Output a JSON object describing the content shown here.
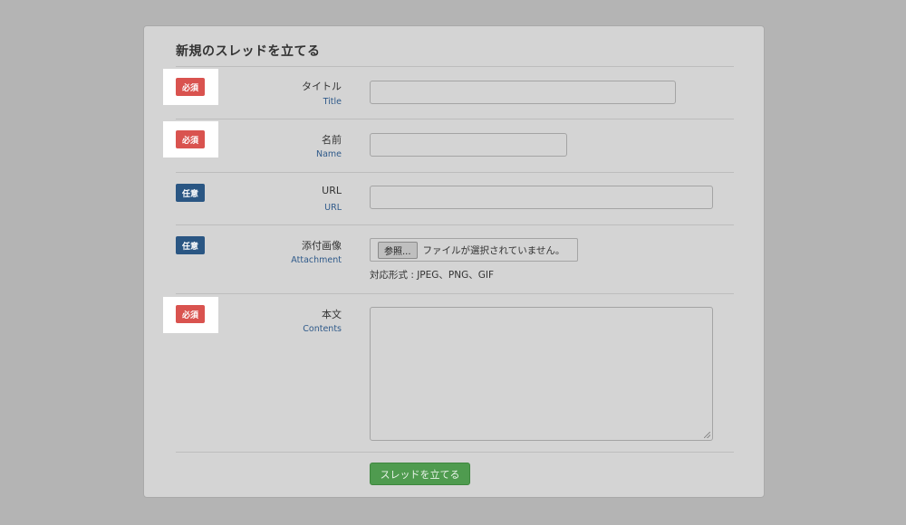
{
  "form": {
    "title": "新規のスレッドを立てる",
    "badges": {
      "required": "必須",
      "optional": "任意"
    },
    "fields": {
      "title": {
        "label": "タイトル",
        "sub": "Title"
      },
      "name": {
        "label": "名前",
        "sub": "Name"
      },
      "url": {
        "label": "URL",
        "sub": "URL"
      },
      "attachment": {
        "label": "添付画像",
        "sub": "Attachment",
        "browse": "参照...",
        "status": "ファイルが選択されていません。",
        "hint": "対応形式 : JPEG、PNG、GIF"
      },
      "contents": {
        "label": "本文",
        "sub": "Contents"
      }
    },
    "submit": "スレッドを立てる"
  },
  "colors": {
    "required": "#d9534f",
    "optional": "#2a5683",
    "submit": "#4f9b4f",
    "sublabel": "#2f5a8a"
  }
}
